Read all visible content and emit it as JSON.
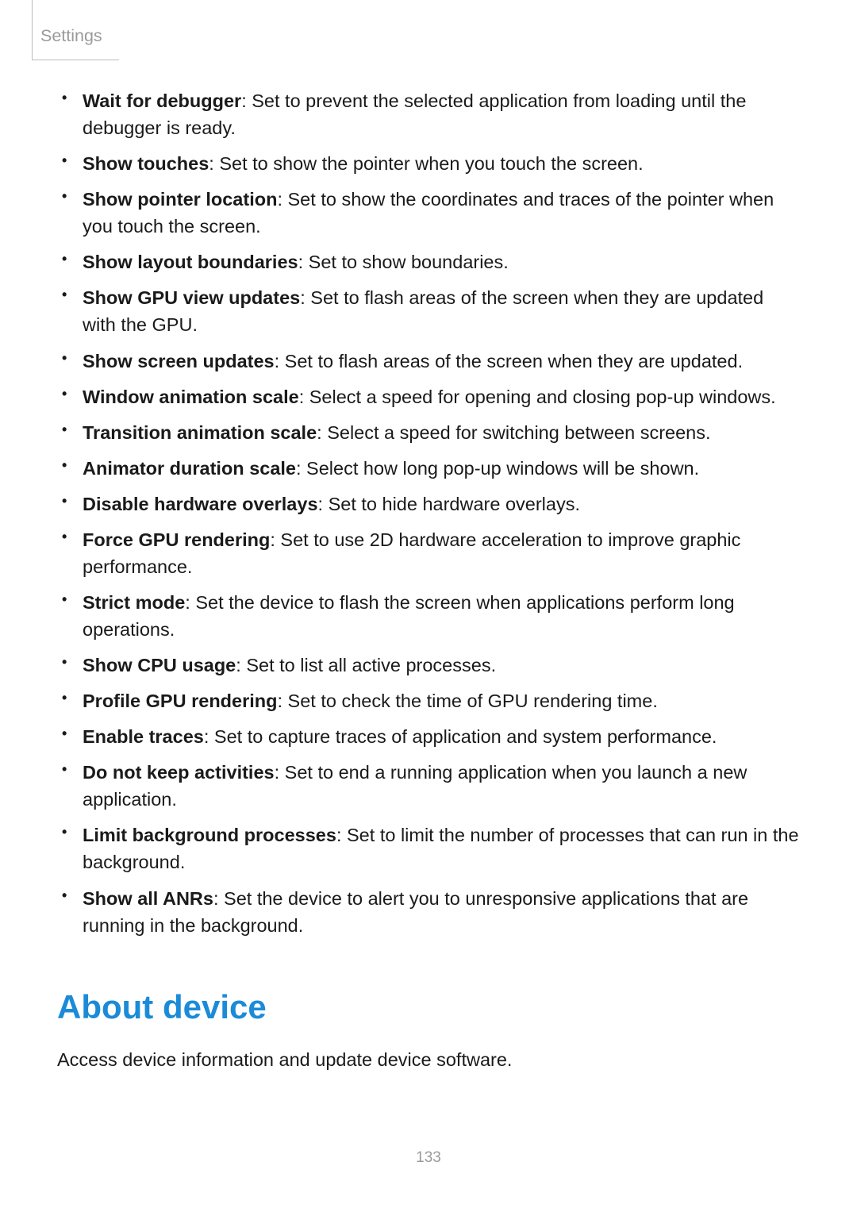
{
  "header": "Settings",
  "options": [
    {
      "title": "Wait for debugger",
      "desc": ": Set to prevent the selected application from loading until the debugger is ready."
    },
    {
      "title": "Show touches",
      "desc": ": Set to show the pointer when you touch the screen."
    },
    {
      "title": "Show pointer location",
      "desc": ": Set to show the coordinates and traces of the pointer when you touch the screen."
    },
    {
      "title": "Show layout boundaries",
      "desc": ": Set to show boundaries."
    },
    {
      "title": "Show GPU view updates",
      "desc": ": Set to flash areas of the screen when they are updated with the GPU."
    },
    {
      "title": "Show screen updates",
      "desc": ": Set to flash areas of the screen when they are updated."
    },
    {
      "title": "Window animation scale",
      "desc": ": Select a speed for opening and closing pop-up windows."
    },
    {
      "title": "Transition animation scale",
      "desc": ": Select a speed for switching between screens."
    },
    {
      "title": "Animator duration scale",
      "desc": ": Select how long pop-up windows will be shown."
    },
    {
      "title": "Disable hardware overlays",
      "desc": ": Set to hide hardware overlays."
    },
    {
      "title": "Force GPU rendering",
      "desc": ": Set to use 2D hardware acceleration to improve graphic performance."
    },
    {
      "title": "Strict mode",
      "desc": ": Set the device to flash the screen when applications perform long operations."
    },
    {
      "title": "Show CPU usage",
      "desc": ": Set to list all active processes."
    },
    {
      "title": "Profile GPU rendering",
      "desc": ": Set to check the time of GPU rendering time."
    },
    {
      "title": "Enable traces",
      "desc": ": Set to capture traces of application and system performance."
    },
    {
      "title": "Do not keep activities",
      "desc": ": Set to end a running application when you launch a new application."
    },
    {
      "title": "Limit background processes",
      "desc": ": Set to limit the number of processes that can run in the background."
    },
    {
      "title": "Show all ANRs",
      "desc": ": Set the device to alert you to unresponsive applications that are running in the background."
    }
  ],
  "section": {
    "heading": "About device",
    "body": "Access device information and update device software."
  },
  "page_number": "133"
}
